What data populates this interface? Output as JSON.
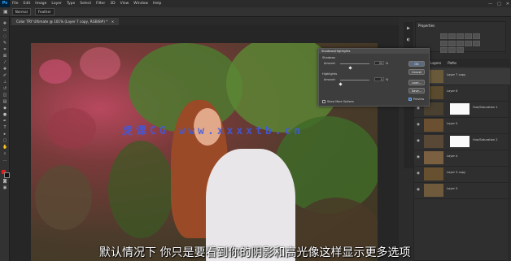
{
  "menubar": {
    "logo": "Ps",
    "items": [
      "File",
      "Edit",
      "Image",
      "Layer",
      "Type",
      "Select",
      "Filter",
      "3D",
      "View",
      "Window",
      "Help"
    ],
    "window_controls": [
      "—",
      "□",
      "✕"
    ]
  },
  "options_bar": {
    "mode_label": "Normal",
    "field_label": "sample",
    "field_value": "Feather"
  },
  "document_tab": {
    "title": "Color TRY Ultimate @ 101% (Layer 7 copy, RGB/8#) *",
    "close_glyph": "×"
  },
  "dialog": {
    "title": "Shadows/Highlights",
    "shadows_section": "Shadows",
    "shadows_amount_label": "Amount:",
    "shadows_amount_value": "35",
    "highlights_section": "Highlights",
    "highlights_amount_label": "Amount:",
    "highlights_amount_value": "0",
    "unit": "%",
    "show_more_options": "Show More Options",
    "preview_label": "Preview",
    "buttons": {
      "ok": "OK",
      "cancel": "Cancel",
      "load": "Load...",
      "save": "Save..."
    },
    "shadows_amount_pct": 35,
    "highlights_amount_pct": 0
  },
  "histogram_panel": {
    "title": "Properties"
  },
  "layers_panel": {
    "tabs": [
      "Layers",
      "Paths"
    ],
    "rows": [
      {
        "name": "Layer 7 copy",
        "has_mask": false,
        "thumb_color": "#6a5a3a"
      },
      {
        "name": "Layer 6",
        "has_mask": false,
        "thumb_color": "#5b4a2e"
      },
      {
        "name": "Hue/Saturation 1",
        "has_mask": true,
        "thumb_color": "#4a4030"
      },
      {
        "name": "Layer 5",
        "has_mask": false,
        "thumb_color": "#6a5030"
      },
      {
        "name": "Hue/Saturation 2",
        "has_mask": true,
        "thumb_color": "#584835"
      },
      {
        "name": "Layer 4",
        "has_mask": false,
        "thumb_color": "#7a6040"
      },
      {
        "name": "Layer 3 copy",
        "has_mask": false,
        "thumb_color": "#665030"
      },
      {
        "name": "Layer 3",
        "has_mask": false,
        "thumb_color": "#705a3c"
      }
    ]
  },
  "watermark": "虎课CG www.xxxxtb.cn",
  "subtitle": "默认情况下 你只是要看到你的阴影和高光像这样显示更多选项",
  "colors": {
    "accent": "#31a8ff",
    "panel_bg": "#2c2c2c",
    "canvas_bg": "#262626"
  }
}
